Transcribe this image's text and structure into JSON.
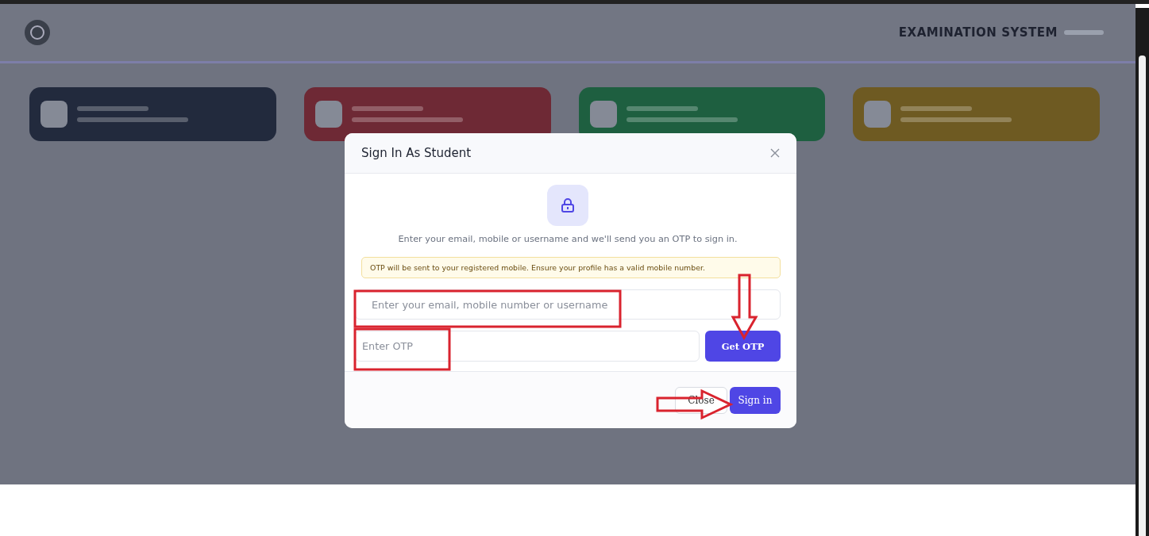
{
  "header": {
    "title": "EXAMINATION SYSTEM"
  },
  "portal_cards": [
    {
      "color": "#222a3d"
    },
    {
      "color": "#6e2935"
    },
    {
      "color": "#1e5f40"
    },
    {
      "color": "#6e5a22"
    }
  ],
  "modal": {
    "title": "Sign In As Student",
    "description": "Enter your email, mobile or username and we'll send you an OTP to sign in.",
    "notice": "OTP will be sent to your registered mobile. Ensure your profile has a valid mobile number.",
    "email_field": {
      "placeholder": "Enter your email, mobile number or username"
    },
    "otp_field": {
      "placeholder": "Enter OTP"
    },
    "get_otp_button": "Get OTP",
    "buttons": [
      {
        "kind": "secondary",
        "label": "Close"
      },
      {
        "kind": "primary",
        "label": "Sign in"
      }
    ]
  }
}
